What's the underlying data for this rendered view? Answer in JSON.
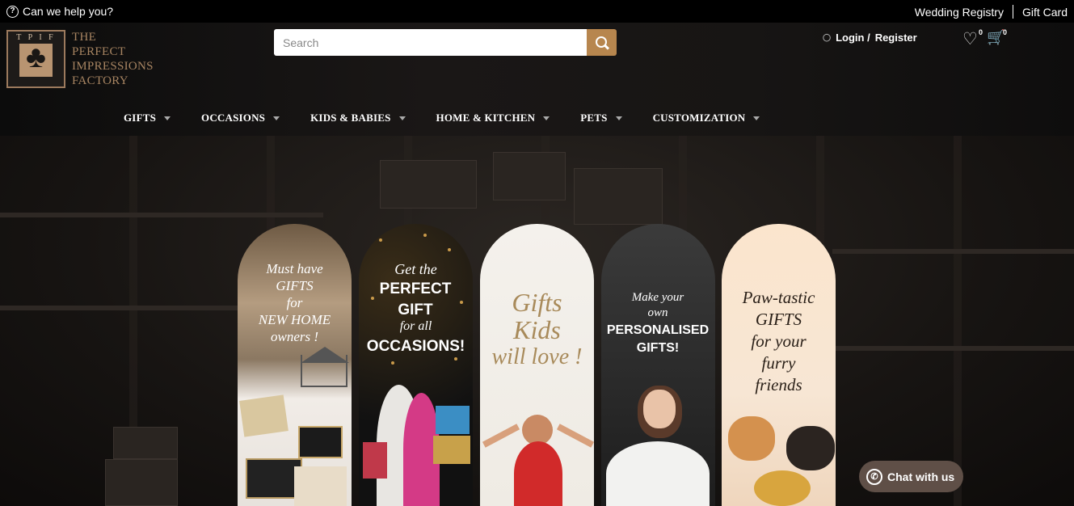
{
  "topbar": {
    "help_label": "Can we help you?",
    "help_icon": "question-circle-icon",
    "links": [
      "Wedding Registry",
      "Gift Card"
    ]
  },
  "header": {
    "logo": {
      "abbr": "T P I F",
      "lines": [
        "THE",
        "PERFECT",
        "IMPRESSIONS",
        "FACTORY"
      ]
    },
    "search": {
      "placeholder": "Search",
      "value": "",
      "icon": "search-icon"
    },
    "account": {
      "login": "Login /",
      "register": "Register",
      "icon": "user-icon"
    },
    "wishlist": {
      "icon": "heart-icon",
      "count": "0"
    },
    "cart": {
      "icon": "cart-icon",
      "count": "0"
    }
  },
  "nav": [
    {
      "label": "GIFTS"
    },
    {
      "label": "OCCASIONS"
    },
    {
      "label": "KIDS & BABIES"
    },
    {
      "label": "HOME & KITCHEN"
    },
    {
      "label": "PETS"
    },
    {
      "label": "CUSTOMIZATION"
    }
  ],
  "hero": {
    "panels": [
      {
        "lines": [
          "Must have",
          "GIFTS",
          "for",
          "NEW HOME",
          "owners !"
        ]
      },
      {
        "script": "Get the",
        "bold": "PERFECT GIFT",
        "script2": "for all",
        "bold2": "OCCASIONS!"
      },
      {
        "lines": [
          "Gifts",
          "Kids",
          "will love !"
        ]
      },
      {
        "script": "Make your own",
        "bold": "PERSONALISED GIFTS!"
      },
      {
        "lines": [
          "Paw-tastic",
          "GIFTS",
          "for your",
          "furry",
          "friends"
        ]
      }
    ]
  },
  "chat": {
    "label": "Chat with us",
    "icon": "whatsapp-icon"
  },
  "colors": {
    "accent": "#b7864e",
    "cart": "#c9805b",
    "background": "#000000"
  }
}
